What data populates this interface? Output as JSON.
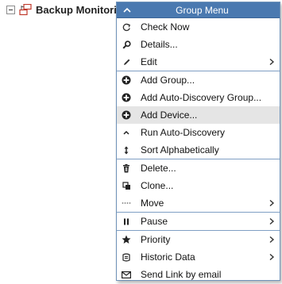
{
  "tree": {
    "node_label": "Backup Monitoring",
    "expander_state": "expanded",
    "icon": "device-group-icon"
  },
  "menu": {
    "title": "Group Menu",
    "header_icon": "collapse-up-icon",
    "groups": [
      [
        {
          "label": "Check Now",
          "icon": "refresh-icon",
          "submenu": false
        },
        {
          "label": "Details...",
          "icon": "search-icon",
          "submenu": false
        },
        {
          "label": "Edit",
          "icon": "pencil-icon",
          "submenu": true
        }
      ],
      [
        {
          "label": "Add Group...",
          "icon": "plus-circle-icon",
          "submenu": false
        },
        {
          "label": "Add Auto-Discovery Group...",
          "icon": "plus-circle-icon",
          "submenu": false
        },
        {
          "label": "Add Device...",
          "icon": "plus-circle-icon",
          "submenu": false,
          "highlighted": true
        },
        {
          "label": "Run Auto-Discovery",
          "icon": "caret-up-icon",
          "submenu": false
        },
        {
          "label": "Sort Alphabetically",
          "icon": "sort-arrows-icon",
          "submenu": false
        }
      ],
      [
        {
          "label": "Delete...",
          "icon": "trash-icon",
          "submenu": false
        },
        {
          "label": "Clone...",
          "icon": "clone-icon",
          "submenu": false
        },
        {
          "label": "Move",
          "icon": "move-dots-icon",
          "submenu": true
        }
      ],
      [
        {
          "label": "Pause",
          "icon": "pause-icon",
          "submenu": true
        }
      ],
      [
        {
          "label": "Priority",
          "icon": "star-icon",
          "submenu": true
        },
        {
          "label": "Historic Data",
          "icon": "historic-data-icon",
          "submenu": true
        },
        {
          "label": "Send Link by email",
          "icon": "envelope-icon",
          "submenu": false
        }
      ]
    ]
  },
  "colors": {
    "header_bg": "#4a79b0",
    "separator": "#7f9fc4",
    "highlight": "#e5e5e5"
  }
}
